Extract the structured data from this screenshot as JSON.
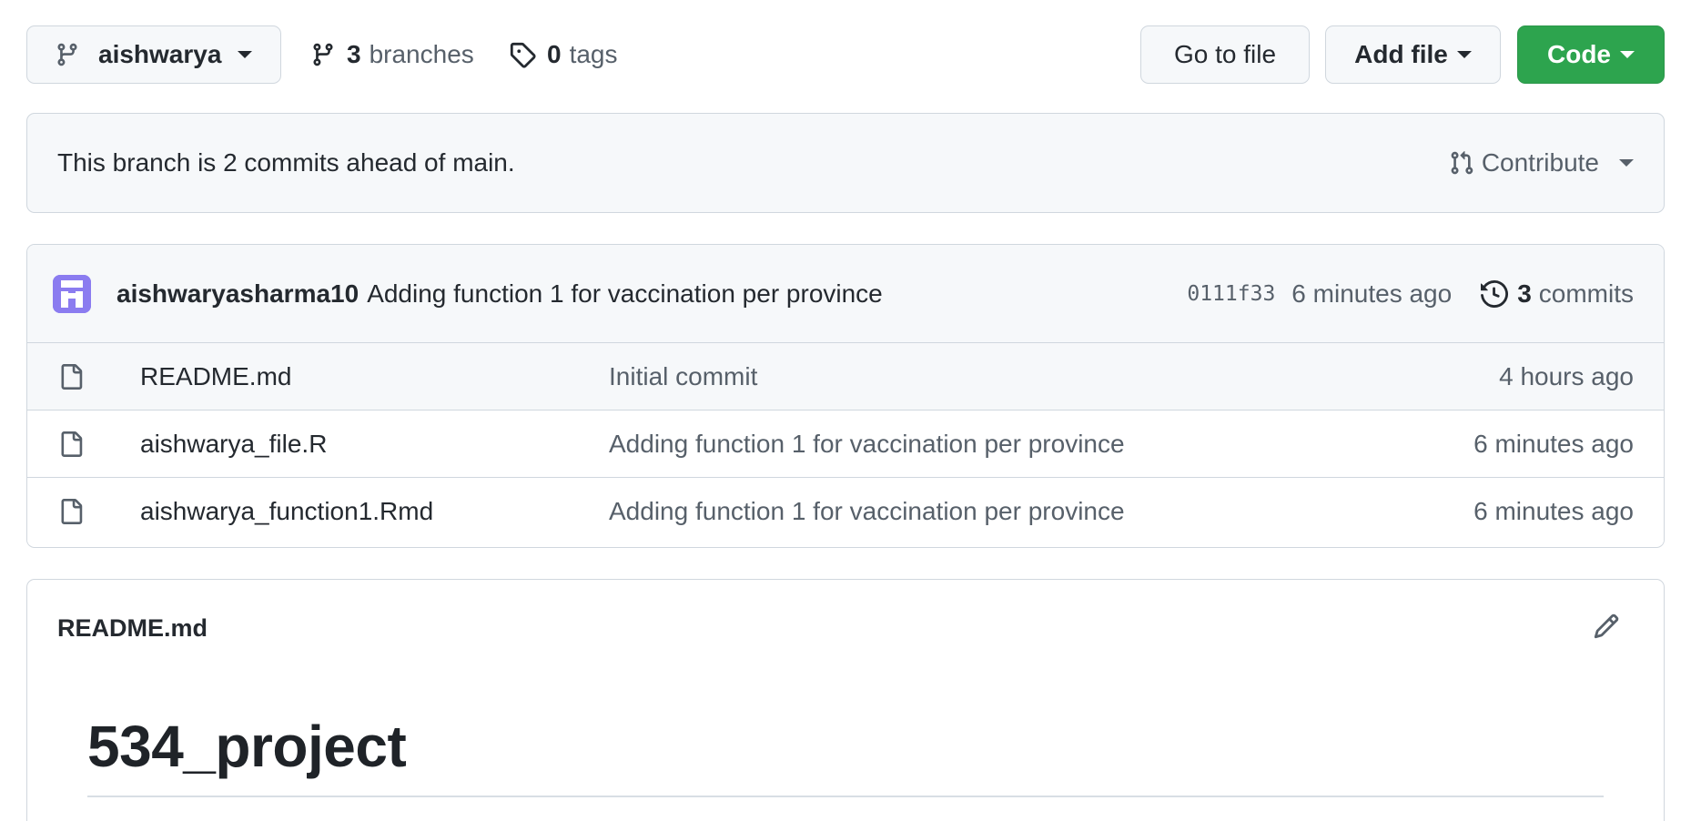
{
  "toolbar": {
    "branch_name": "aishwarya",
    "branches_count": "3",
    "branches_label": "branches",
    "tags_count": "0",
    "tags_label": "tags",
    "go_to_file_label": "Go to file",
    "add_file_label": "Add file",
    "code_label": "Code"
  },
  "banner": {
    "message": "This branch is 2 commits ahead of main.",
    "contribute_label": "Contribute"
  },
  "latest_commit": {
    "author": "aishwaryasharma10",
    "message": "Adding function 1 for vaccination per province",
    "sha": "0111f33",
    "time": "6 minutes ago",
    "commits_count": "3",
    "commits_label": "commits"
  },
  "files": [
    {
      "name": "README.md",
      "message": "Initial commit",
      "time": "4 hours ago"
    },
    {
      "name": "aishwarya_file.R",
      "message": "Adding function 1 for vaccination per province",
      "time": "6 minutes ago"
    },
    {
      "name": "aishwarya_function1.Rmd",
      "message": "Adding function 1 for vaccination per province",
      "time": "6 minutes ago"
    }
  ],
  "readme": {
    "title": "README.md",
    "heading": "534_project"
  },
  "colors": {
    "primary_button": "#2da44e",
    "border": "#d0d7de",
    "muted_text": "#57606a",
    "avatar": "#8b7cf0"
  },
  "icons": [
    "git-branch-icon",
    "tag-icon",
    "git-pull-request-icon",
    "history-icon",
    "file-icon",
    "pencil-icon"
  ]
}
